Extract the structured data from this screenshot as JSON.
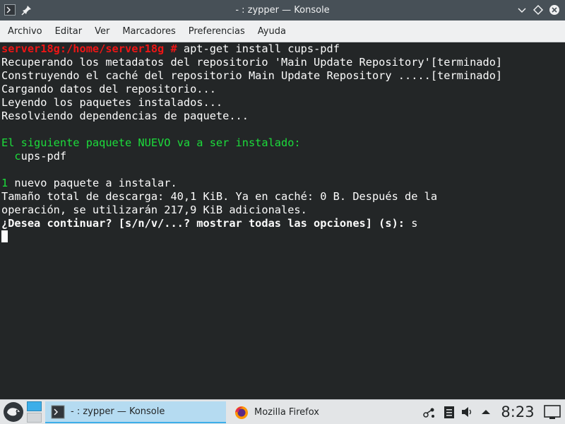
{
  "window": {
    "title": "- : zypper — Konsole"
  },
  "menu": [
    "Archivo",
    "Editar",
    "Ver",
    "Marcadores",
    "Preferencias",
    "Ayuda"
  ],
  "terminal": {
    "prompt": "server18g:/home/server18g #",
    "command": " apt-get install cups-pdf",
    "lines": [
      "Recuperando los metadatos del repositorio 'Main Update Repository'[terminado]",
      "Construyendo el caché del repositorio Main Update Repository .....[terminado]",
      "Cargando datos del repositorio...",
      "Leyendo los paquetes instalados...",
      "Resolviendo dependencias de paquete..."
    ],
    "new_pkg_header": "El siguiente paquete NUEVO va a ser instalado:",
    "pkg_first": "  c",
    "pkg_rest": "ups-pdf",
    "count_num": "1",
    "count_rest": " nuevo paquete a instalar.",
    "size_line1": "Tamaño total de descarga: 40,1 KiB. Ya en caché: 0 B. Después de la",
    "size_line2": "operación, se utilizarán 217,9 KiB adicionales.",
    "question": "¿Desea continuar? [s/n/v/...? mostrar todas las opciones] (s):",
    "answer": " s"
  },
  "taskbar": {
    "tasks": [
      {
        "label": "- : zypper — Konsole",
        "icon": "konsole-icon"
      },
      {
        "label": "Mozilla Firefox",
        "icon": "firefox-icon"
      }
    ],
    "clock": "8:23"
  },
  "colors": {
    "titlebar": "#475057",
    "terminal_bg": "#232627",
    "prompt": "#ed1515",
    "green": "#1cdc3b",
    "accent": "#3daee9"
  }
}
